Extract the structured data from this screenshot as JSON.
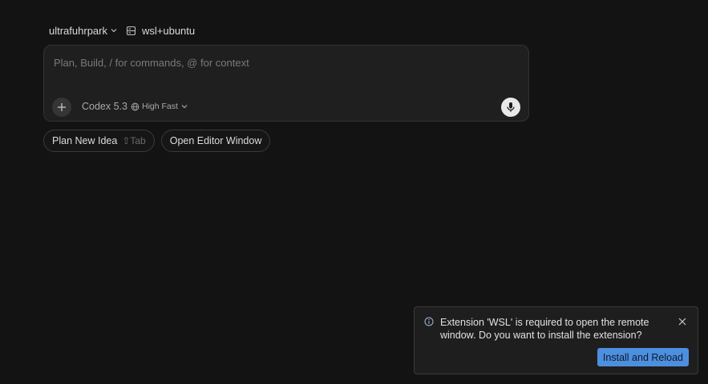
{
  "header": {
    "project": "ultrafuhrpark",
    "project_icon": "chevron-down-icon",
    "environment": "wsl+ubuntu",
    "environment_icon": "server-icon"
  },
  "composer": {
    "placeholder": "Plan, Build, / for commands, @ for context",
    "value": "",
    "add_icon": "plus-icon",
    "model": {
      "name": "Codex 5.3",
      "mode": "High Fast",
      "icon": "globe-icon"
    },
    "mic_icon": "microphone-icon"
  },
  "chips": [
    {
      "label": "Plan New Idea",
      "shortcut": "⇧Tab"
    },
    {
      "label": "Open Editor Window",
      "shortcut": ""
    }
  ],
  "notification": {
    "icon": "info-icon",
    "message": "Extension 'WSL' is required to open the remote window. Do you want to install the extension?",
    "action_label": "Install and Reload",
    "close_icon": "close-icon"
  },
  "colors": {
    "background": "#131313",
    "panel": "#1f1f1f",
    "accent": "#4d8fdf"
  }
}
